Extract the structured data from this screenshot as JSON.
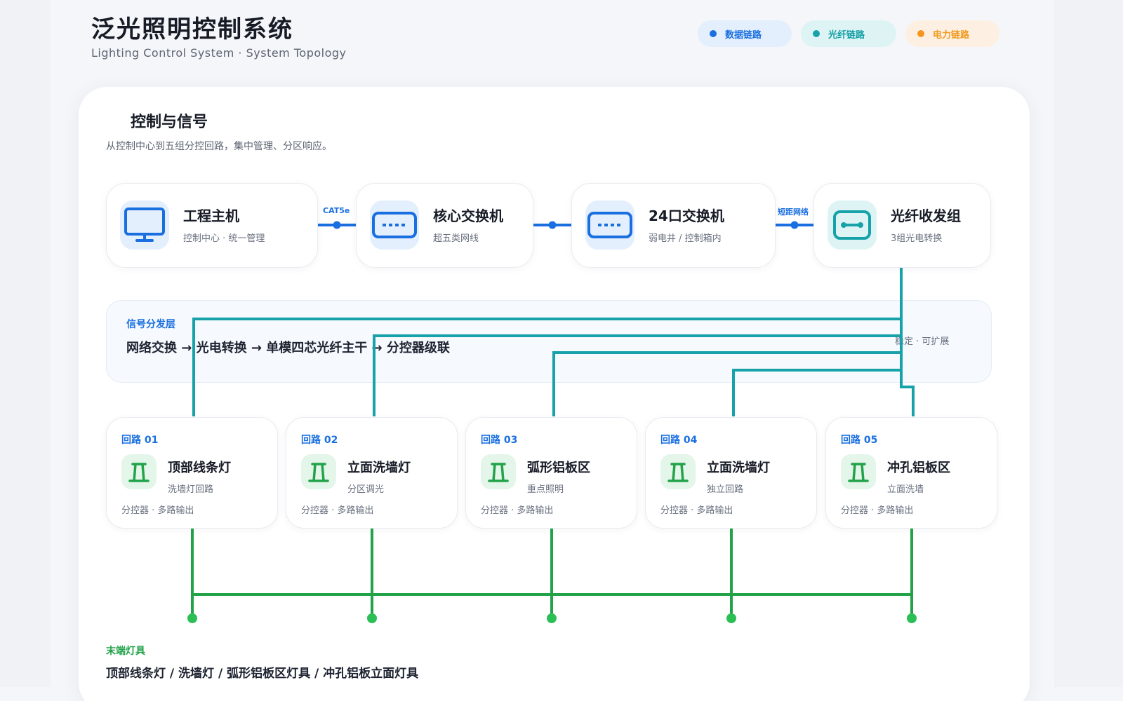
{
  "header": {
    "title": "泛光照明控制系统",
    "subtitle": "Lighting Control System · System Topology"
  },
  "legend": {
    "data": "数据链路",
    "fiber": "光纤链路",
    "power": "电力链路"
  },
  "colors": {
    "data": "#1a6fe0",
    "fiber": "#17a2aa",
    "power": "#f7941d",
    "lighting": "#22a34a"
  },
  "section": {
    "title": "控制与信号",
    "desc": "从控制中心到五组分控回路，集中管理、分区响应。"
  },
  "devices": [
    {
      "icon": "monitor-icon",
      "name": "工程主机",
      "sub": "控制中心 · 统一管理"
    },
    {
      "icon": "switch-icon",
      "name": "核心交换机",
      "sub": "超五类网线"
    },
    {
      "icon": "switch-icon",
      "name": "24口交换机",
      "sub": "弱电井 / 控制箱内"
    },
    {
      "icon": "fiber-transceiver-icon",
      "name": "光纤收发组",
      "sub": "3组光电转换"
    }
  ],
  "links": {
    "host_to_core": "CAT5e",
    "switch_to_fiber": "短距网络"
  },
  "signal": {
    "head": "信号分发层",
    "flow": "网络交换 → 光电转换 → 单模四芯光纤主干 → 分控器级联",
    "note": "稳定 · 可扩展"
  },
  "circuits": [
    {
      "num": "回路 01",
      "name": "顶部线条灯",
      "sub": "洗墙灯回路",
      "foot": "分控器 · 多路输出"
    },
    {
      "num": "回路 02",
      "name": "立面洗墙灯",
      "sub": "分区调光",
      "foot": "分控器 · 多路输出"
    },
    {
      "num": "回路 03",
      "name": "弧形铝板区",
      "sub": "重点照明",
      "foot": "分控器 · 多路输出"
    },
    {
      "num": "回路 04",
      "name": "立面洗墙灯",
      "sub": "独立回路",
      "foot": "分控器 · 多路输出"
    },
    {
      "num": "回路 05",
      "name": "冲孔铝板区",
      "sub": "立面洗墙",
      "foot": "分控器 · 多路输出"
    }
  ],
  "terminal": {
    "head": "末端灯具",
    "list": "顶部线条灯 / 洗墙灯 / 弧形铝板区灯具 / 冲孔铝板立面灯具"
  }
}
